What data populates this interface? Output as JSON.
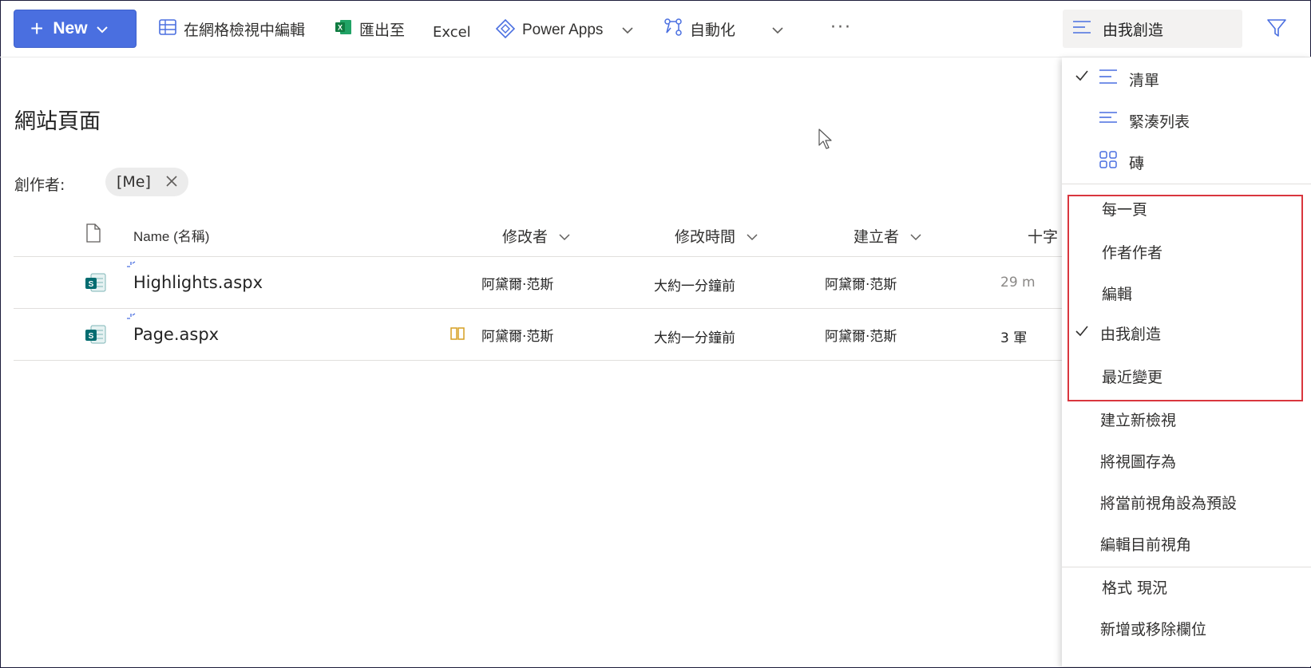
{
  "toolbar": {
    "new_label": "New",
    "grid_edit_label": "在網格檢視中編輯",
    "export_label": "匯出至",
    "excel_label": "Excel",
    "power_apps_label": "Power Apps",
    "automate_label": "自動化",
    "more_label": "···",
    "current_view_label": "由我創造"
  },
  "page": {
    "title": "網站頁面",
    "filter_label": "創作者:",
    "filter_pill": "[Me]"
  },
  "columns": {
    "name": "Name (名稱)",
    "modified_by": "修改者",
    "modified": "修改時間",
    "created_by": "建立者",
    "extra": "十字"
  },
  "rows": [
    {
      "name": "Highlights.aspx",
      "modified_by": "阿黛爾·范斯",
      "modified": "大約一分鐘前",
      "created_by": "阿黛爾·范斯",
      "extra": "29 m"
    },
    {
      "name": "Page.aspx",
      "modified_by": "阿黛爾·范斯",
      "modified": "大約一分鐘前",
      "created_by": "阿黛爾·范斯",
      "extra": "3 軍"
    }
  ],
  "menu": {
    "layouts": [
      "清單",
      "緊湊列表",
      "磚"
    ],
    "views": [
      "每一頁",
      "作者作者",
      "編輯",
      "由我創造",
      "最近變更"
    ],
    "actions": [
      "建立新檢視",
      "將視圖存為",
      "將當前視角設為預設",
      "編輯目前視角"
    ],
    "footer": [
      "格式 現況",
      "新增或移除欄位"
    ]
  },
  "colors": {
    "accent": "#4a6fe0",
    "highlight_border": "#d9363e",
    "sharepoint_green": "#036c70"
  }
}
